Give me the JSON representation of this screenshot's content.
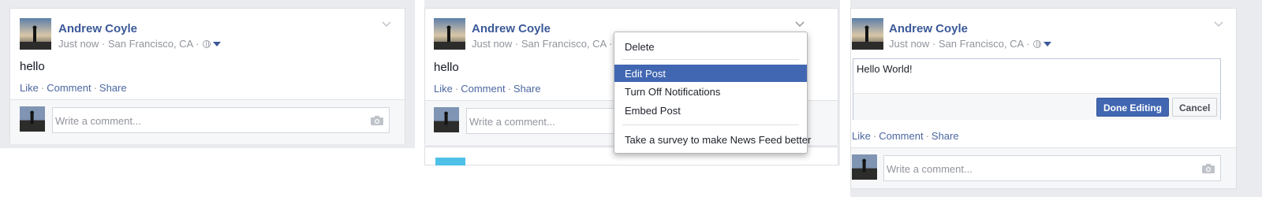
{
  "posts": [
    {
      "author": "Andrew Coyle",
      "meta": "Just now · San Francisco, CA ·",
      "text": "hello",
      "actions": {
        "like": "Like",
        "comment": "Comment",
        "share": "Share",
        "sep": "·"
      },
      "comment_placeholder": "Write a comment..."
    },
    {
      "author": "Andrew Coyle",
      "meta": "Just now · San Francisco, CA ·",
      "text": "hello",
      "actions": {
        "like": "Like",
        "comment": "Comment",
        "share": "Share",
        "sep": "·"
      },
      "comment_placeholder": "Write a comment..."
    },
    {
      "author": "Andrew Coyle",
      "meta": "Just now · San Francisco, CA ·",
      "edit_text": "Hello World!",
      "done_label": "Done Editing",
      "cancel_label": "Cancel",
      "actions": {
        "like": "Like",
        "comment": "Comment",
        "share": "Share",
        "sep": "·"
      },
      "comment_placeholder": "Write a comment..."
    }
  ],
  "menu": {
    "items": [
      "Delete",
      "Edit Post",
      "Turn Off Notifications",
      "Embed Post",
      "Take a survey to make News Feed better"
    ],
    "active": "Edit Post"
  },
  "colors": {
    "brand": "#3b5998",
    "link": "#4b67a1",
    "menu_highlight": "#4267b2",
    "feed_bg": "#e9ebee"
  },
  "icons": [
    "avatar-photo",
    "chevron-down-icon",
    "globe-icon",
    "caret-down-icon",
    "camera-icon"
  ]
}
